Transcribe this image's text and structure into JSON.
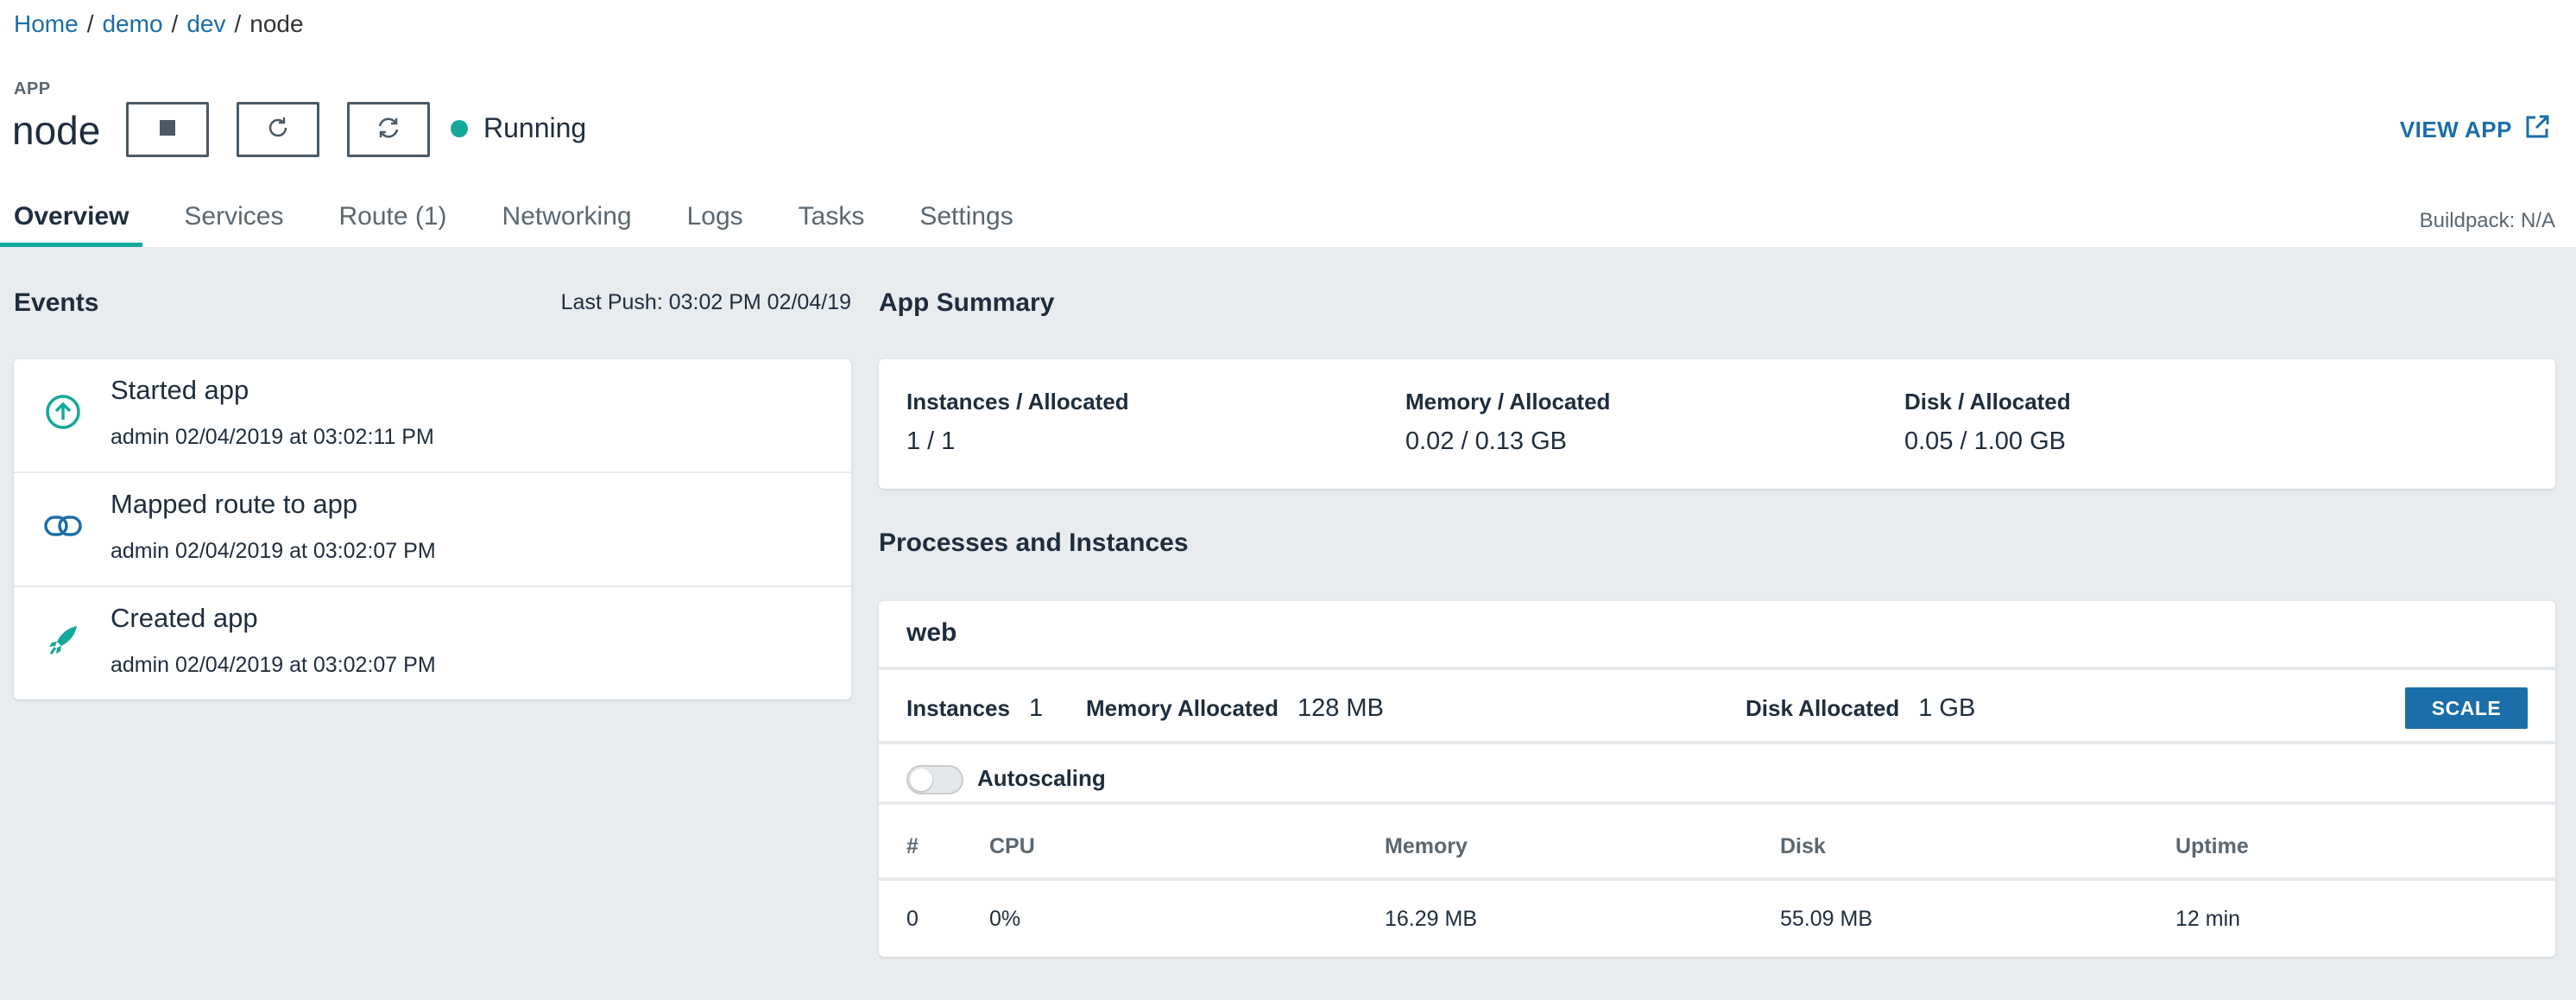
{
  "breadcrumb": {
    "items": [
      "Home",
      "demo",
      "dev"
    ],
    "current": "node",
    "separator": "/"
  },
  "app": {
    "label": "APP",
    "name": "node",
    "status": "Running",
    "status_color": "#14a89b",
    "controls": [
      "stop-icon",
      "restart-icon",
      "restage-icon"
    ],
    "view_app_label": "VIEW APP"
  },
  "tabs": [
    {
      "label": "Overview",
      "active": true
    },
    {
      "label": "Services",
      "active": false
    },
    {
      "label": "Route (1)",
      "active": false
    },
    {
      "label": "Networking",
      "active": false
    },
    {
      "label": "Logs",
      "active": false
    },
    {
      "label": "Tasks",
      "active": false
    },
    {
      "label": "Settings",
      "active": false
    }
  ],
  "buildpack": "Buildpack: N/A",
  "events": {
    "title": "Events",
    "last_push": "Last Push: 03:02 PM 02/04/19",
    "items": [
      {
        "icon": "arrow-up-circle-icon",
        "title": "Started app",
        "meta": "admin 02/04/2019 at 03:02:11 PM"
      },
      {
        "icon": "link-icon",
        "title": "Mapped route to app",
        "meta": "admin 02/04/2019 at 03:02:07 PM"
      },
      {
        "icon": "rocket-icon",
        "title": "Created app",
        "meta": "admin 02/04/2019 at 03:02:07 PM"
      }
    ]
  },
  "summary": {
    "title": "App Summary",
    "instances_label": "Instances / Allocated",
    "instances_value": "1 / 1",
    "memory_label": "Memory / Allocated",
    "memory_value": "0.02 / 0.13 GB",
    "disk_label": "Disk / Allocated",
    "disk_value": "0.05 / 1.00 GB"
  },
  "processes": {
    "title": "Processes and Instances",
    "name": "web",
    "instances_label": "Instances",
    "instances_value": "1",
    "memory_label": "Memory Allocated",
    "memory_value": "128 MB",
    "disk_label": "Disk Allocated",
    "disk_value": "1 GB",
    "scale_label": "SCALE",
    "autoscaling_label": "Autoscaling",
    "autoscaling_enabled": false,
    "table": {
      "headers": [
        "#",
        "CPU",
        "Memory",
        "Disk",
        "Uptime"
      ],
      "rows": [
        [
          "0",
          "0%",
          "16.29 MB",
          "55.09 MB",
          "12 min"
        ]
      ]
    }
  },
  "colors": {
    "accent": "#14a89b",
    "link": "#1b6ea8",
    "background": "#e8ecee"
  }
}
